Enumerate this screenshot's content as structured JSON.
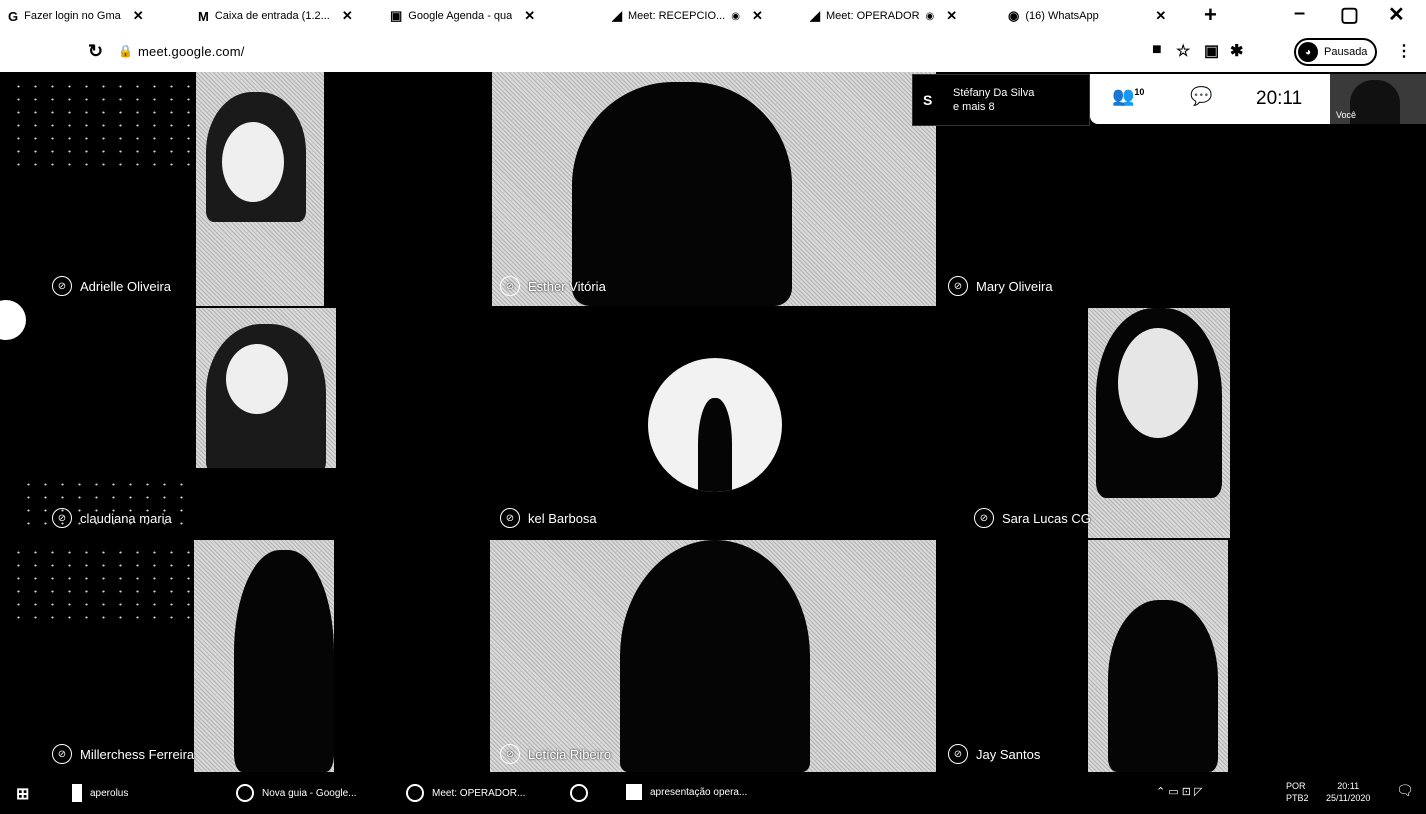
{
  "browser": {
    "tabs": [
      {
        "favicon": "G",
        "label": "Fazer login no Gma"
      },
      {
        "favicon": "M",
        "label": "Caixa de entrada (1.2..."
      },
      {
        "favicon": "▣",
        "label": "Google Agenda - qua"
      },
      {
        "favicon": "◢",
        "label": "Meet: RECEPCIO..."
      },
      {
        "favicon": "◢",
        "label": "Meet: OPERADOR"
      },
      {
        "favicon": "◉",
        "label": "(16) WhatsApp"
      }
    ],
    "new_tab": "+",
    "window_controls": {
      "minimize": "–",
      "maximize": "▢",
      "close": "✕"
    },
    "url": "meet.google.com/",
    "profile_label": "Pausada"
  },
  "meet": {
    "participants": [
      {
        "name": "Adrielle Oliveira"
      },
      {
        "name": "Esther Vitória"
      },
      {
        "name": "Mary Oliveira"
      },
      {
        "name": "claudiana maria"
      },
      {
        "name": "kel Barbosa"
      },
      {
        "name": "Sara Lucas CG"
      },
      {
        "name": "Millerchess Ferreira"
      },
      {
        "name": "Letícia Ribeiro"
      },
      {
        "name": "Jay Santos"
      }
    ],
    "presenter_chip": {
      "initial": "S",
      "line1": "Stéfany Da Silva",
      "line2": "e mais 8"
    },
    "people_count": "10",
    "clock": "20:11",
    "self_label": "Você"
  },
  "taskbar": {
    "items": [
      {
        "label": "aperolus"
      },
      {
        "label": "Nova guia - Google..."
      },
      {
        "label": "Meet: OPERADOR..."
      },
      {
        "label": ""
      },
      {
        "label": "apresentação opera..."
      }
    ],
    "lang": "POR",
    "lang_sub": "PTB2",
    "time": "20:11",
    "date": "25/11/2020"
  }
}
